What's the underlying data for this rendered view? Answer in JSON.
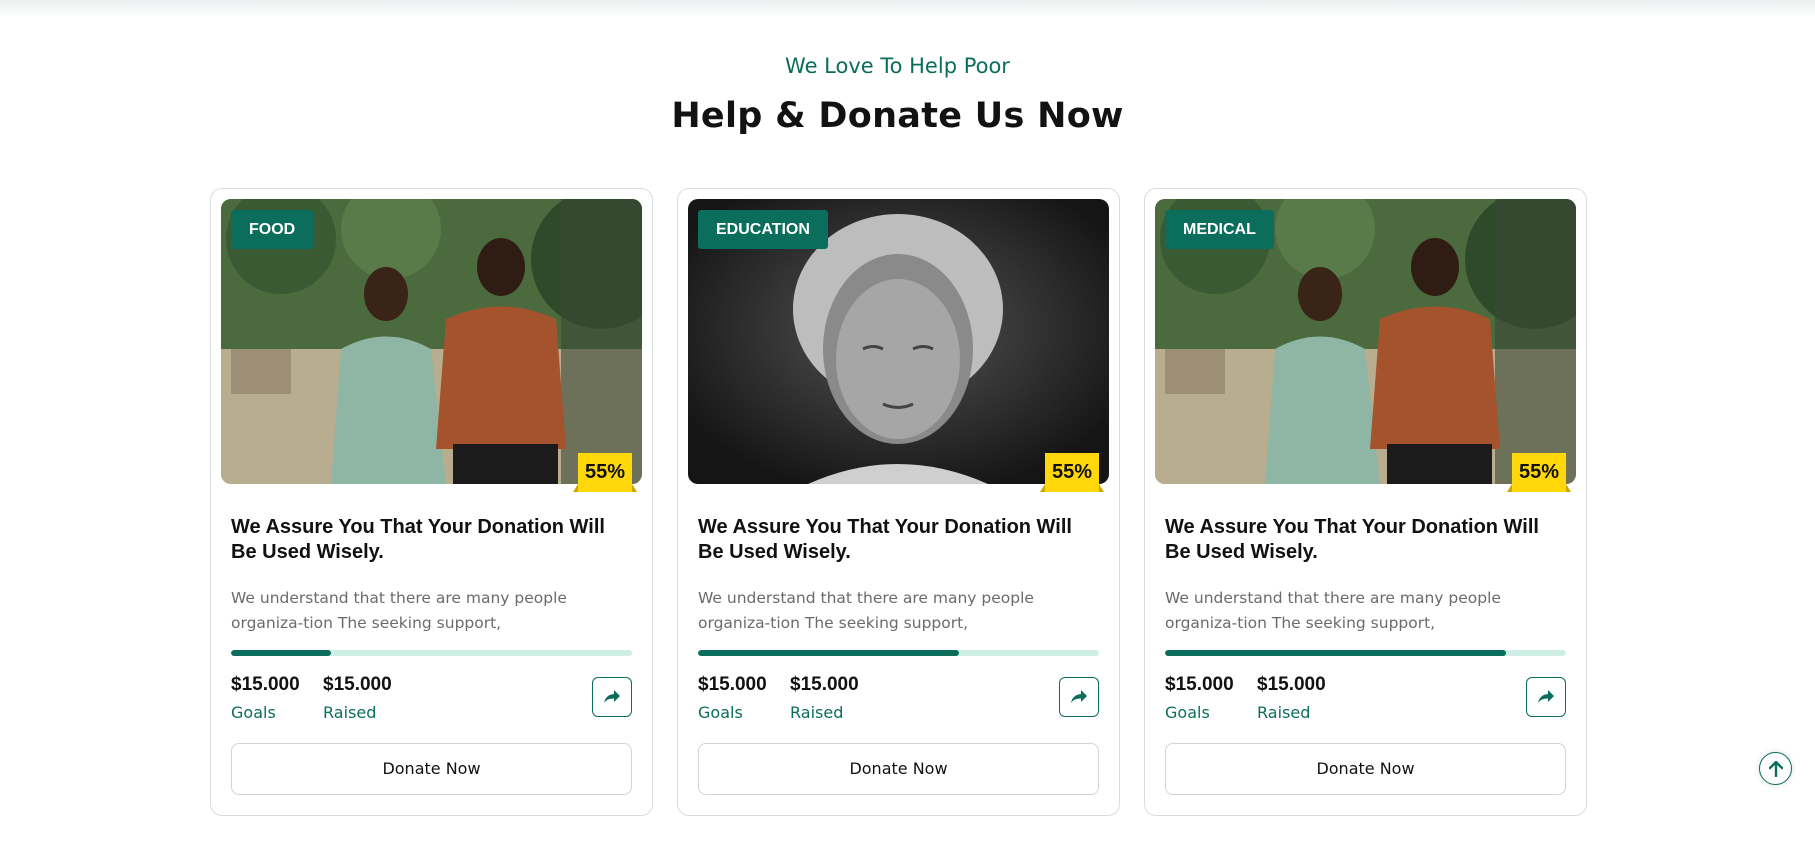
{
  "section": {
    "subtitle": "We Love To Help Poor",
    "title": "Help & Donate Us Now"
  },
  "colors": {
    "accent": "#0b6e5c",
    "badge": "#ffd70a",
    "track": "#cfeee6"
  },
  "cards": [
    {
      "category": "FOOD",
      "image": "two-boys-photo",
      "percent_label": "55%",
      "title": "We Assure You That Your Donation Will Be Used Wisely.",
      "description": "We understand that there are many people organiza-tion The seeking support,",
      "progress": 0.25,
      "goals_value": "$15.000",
      "goals_label": "Goals",
      "raised_value": "$15.000",
      "raised_label": "Raised",
      "share_icon": "share-arrow-icon",
      "button": "Donate Now"
    },
    {
      "category": "EDUCATION",
      "image": "elderly-woman-photo",
      "percent_label": "55%",
      "title": "We Assure You That Your Donation Will Be Used Wisely.",
      "description": "We understand that there are many people organiza-tion The seeking support,",
      "progress": 0.65,
      "goals_value": "$15.000",
      "goals_label": "Goals",
      "raised_value": "$15.000",
      "raised_label": "Raised",
      "share_icon": "share-arrow-icon",
      "button": "Donate Now"
    },
    {
      "category": "MEDICAL",
      "image": "two-boys-photo",
      "percent_label": "55%",
      "title": "We Assure You That Your Donation Will Be Used Wisely.",
      "description": "We understand that there are many people organiza-tion The seeking support,",
      "progress": 0.85,
      "goals_value": "$15.000",
      "goals_label": "Goals",
      "raised_value": "$15.000",
      "raised_label": "Raised",
      "share_icon": "share-arrow-icon",
      "button": "Donate Now"
    }
  ],
  "scroll_top_icon": "arrow-up-icon"
}
